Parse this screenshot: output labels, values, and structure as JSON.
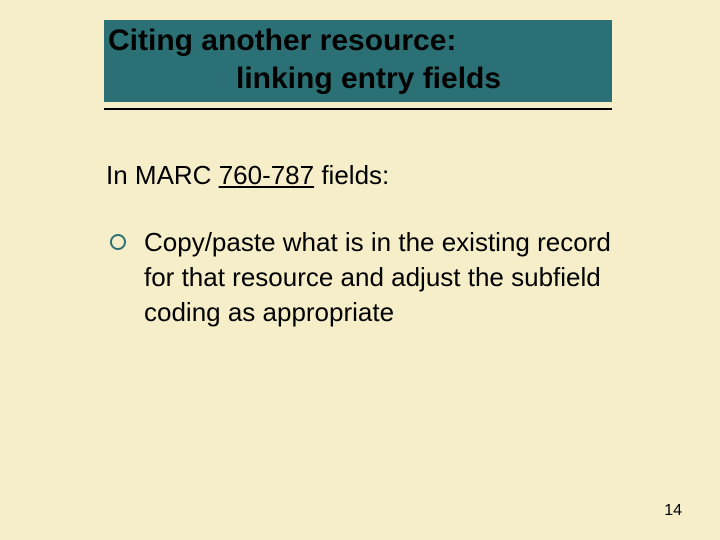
{
  "title": {
    "line1": "Citing another resource:",
    "line2": "linking entry fields"
  },
  "intro": {
    "prefix": "In MARC ",
    "link_text": "760-787",
    "suffix": " fields:"
  },
  "bullets": [
    {
      "text": "Copy/paste what is in the existing record for that resource and adjust the subfield coding as appropriate"
    }
  ],
  "page_number": "14",
  "colors": {
    "background": "#f5eec8",
    "title_bar": "#2b7074",
    "bullet_ring": "#2b7074"
  }
}
